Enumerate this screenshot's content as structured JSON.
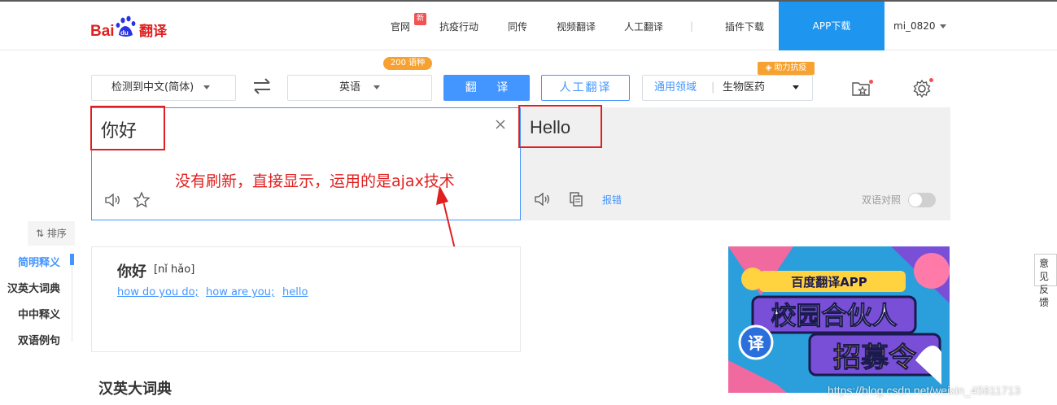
{
  "header": {
    "logo_text": "Bai du 翻译",
    "nav": [
      {
        "label": "官网",
        "badge": "新"
      },
      {
        "label": "抗疫行动"
      },
      {
        "label": "同传"
      },
      {
        "label": "视频翻译"
      },
      {
        "label": "人工翻译"
      },
      {
        "label": "插件下载"
      }
    ],
    "app_download": "APP下载",
    "user": "mi_0820"
  },
  "toolbar": {
    "source_lang": "检测到中文(简体)",
    "target_lang": "英语",
    "lang_count_badge": "200 语种",
    "translate_button": "翻 译",
    "human_translate_button": "人工翻译",
    "domain_label": "通用领域",
    "domain_value": "生物医药",
    "help_badge": "助力抗疫"
  },
  "input": {
    "text": "你好"
  },
  "output": {
    "text": "Hello",
    "report_error": "报错",
    "bilingual_label": "双语对照"
  },
  "annotation": "没有刷新，直接显示，运用的是ajax技术",
  "sidebar": {
    "sort_label": "排序",
    "items": [
      {
        "label": "简明释义",
        "active": true
      },
      {
        "label": "汉英大词典"
      },
      {
        "label": "中中释义"
      },
      {
        "label": "双语例句"
      }
    ]
  },
  "definition": {
    "word": "你好",
    "pinyin": "[nǐ hǎo]",
    "meanings": [
      "how do you do;",
      "how are you;",
      "hello"
    ]
  },
  "section_title": "汉英大词典",
  "ad": {
    "line1": "百度翻译APP",
    "line2": "校园合伙人",
    "line3": "招募令",
    "badge": "译"
  },
  "feedback": {
    "line1": "意见",
    "line2": "反馈"
  },
  "watermark": "https://blog.csdn.net/weixin_45811713",
  "colors": {
    "accent": "#4395ff",
    "app_button": "#1e96f0",
    "annotation": "#e02020",
    "badge_orange": "#f7a131"
  }
}
